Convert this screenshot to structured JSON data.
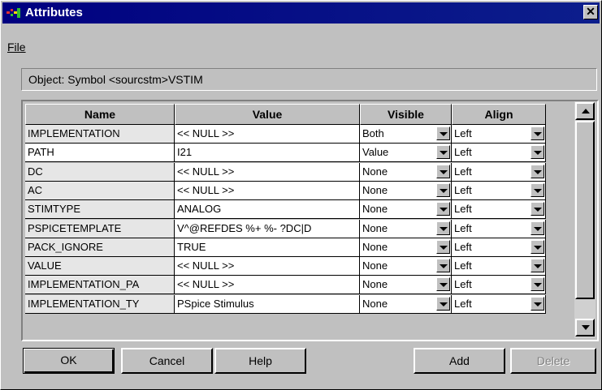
{
  "window": {
    "title": "Attributes",
    "close_glyph": "✕"
  },
  "menu": {
    "file": "File"
  },
  "object_line": "Object:  Symbol <sourcstm>VSTIM",
  "table": {
    "columns": [
      "Name",
      "Value",
      "Visible",
      "Align"
    ],
    "rows": [
      {
        "name": "IMPLEMENTATION",
        "value": "<< NULL >>",
        "visible": "Both",
        "align": "Left",
        "shaded": true
      },
      {
        "name": "PATH",
        "value": "I21",
        "visible": "Value",
        "align": "Left",
        "shaded": false
      },
      {
        "name": "DC",
        "value": "<< NULL >>",
        "visible": "None",
        "align": "Left",
        "shaded": true
      },
      {
        "name": "AC",
        "value": "<< NULL >>",
        "visible": "None",
        "align": "Left",
        "shaded": true
      },
      {
        "name": "STIMTYPE",
        "value": "ANALOG",
        "visible": "None",
        "align": "Left",
        "shaded": true
      },
      {
        "name": "PSPICETEMPLATE",
        "value": "V^@REFDES %+ %- ?DC|D",
        "visible": "None",
        "align": "Left",
        "shaded": true
      },
      {
        "name": "PACK_IGNORE",
        "value": "TRUE",
        "visible": "None",
        "align": "Left",
        "shaded": true
      },
      {
        "name": "VALUE",
        "value": "<< NULL >>",
        "visible": "None",
        "align": "Left",
        "shaded": true
      },
      {
        "name": "IMPLEMENTATION_PA",
        "value": "<< NULL >>",
        "visible": "None",
        "align": "Left",
        "shaded": true
      },
      {
        "name": "IMPLEMENTATION_TY",
        "value": "PSpice Stimulus",
        "visible": "None",
        "align": "Left",
        "shaded": true
      }
    ]
  },
  "buttons": {
    "ok": "OK",
    "cancel": "Cancel",
    "help": "Help",
    "add": "Add",
    "delete": "Delete"
  },
  "colors": {
    "titlebar": "#000080",
    "face": "#c0c0c0"
  },
  "icons": {
    "app": "orcad-app-icon",
    "close": "close-icon"
  }
}
